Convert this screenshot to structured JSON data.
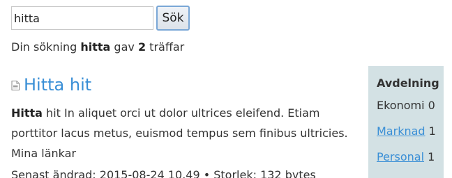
{
  "search": {
    "value": "hitta",
    "button_label": "Sök"
  },
  "summary": {
    "prefix": "Din sökning ",
    "query": "hitta",
    "middle": " gav ",
    "count": "2",
    "suffix": " träffar"
  },
  "results": [
    {
      "title": "Hitta hit",
      "snippet_highlight": "Hitta",
      "snippet_text": " hit In aliquet orci ut dolor ultrices eleifend. Etiam porttitor lacus metus, euismod tempus sem finibus ultricies. Mina länkar",
      "meta": "Senast ändrad: 2015-08-24 10.49 • Storlek: 132 bytes",
      "icon": "document-icon"
    }
  ],
  "facet": {
    "heading": "Avdelning",
    "items": [
      {
        "label": "Ekonomi",
        "count": "0",
        "link": false
      },
      {
        "label": "Marknad",
        "count": "1",
        "link": true
      },
      {
        "label": "Personal",
        "count": "1",
        "link": true
      }
    ]
  }
}
